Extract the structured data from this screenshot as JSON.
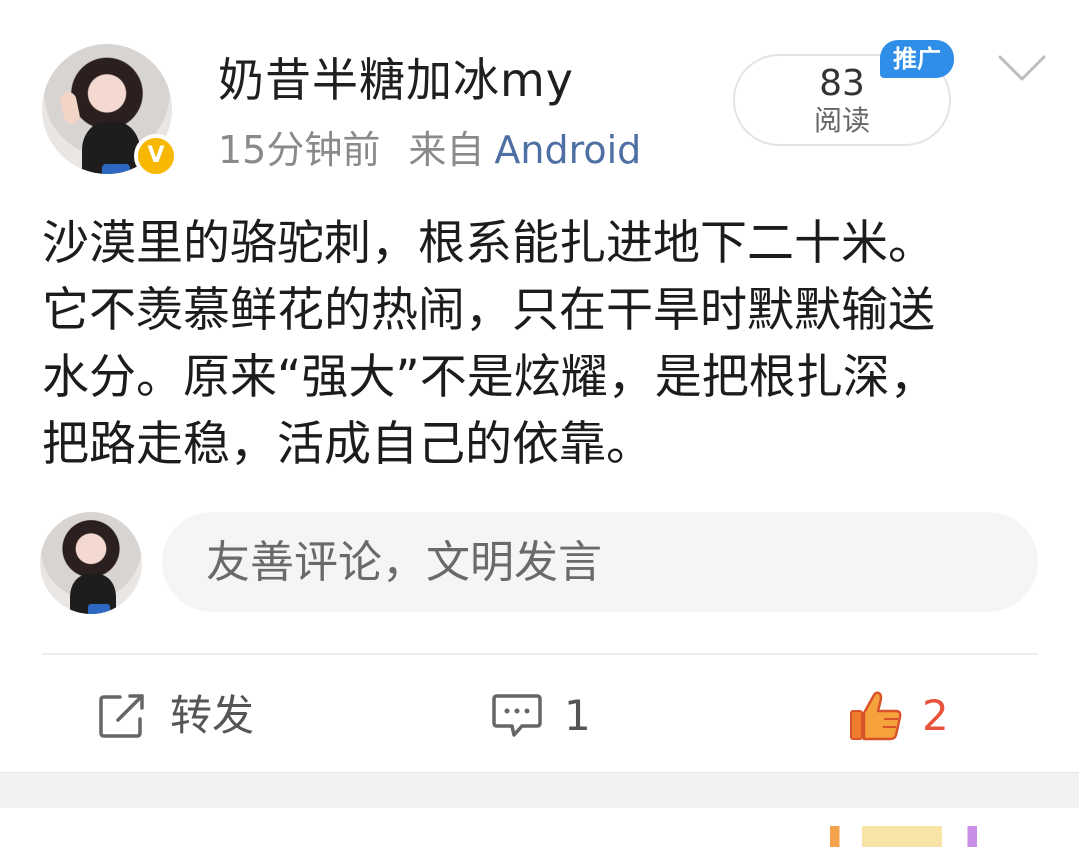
{
  "post": {
    "author": {
      "name": "奶昔半糖加冰my",
      "verified_badge": "V"
    },
    "time": "15分钟前",
    "source_prefix": "来自",
    "source": "Android",
    "read_count": "83",
    "read_label": "阅读",
    "promo_tag": "推广",
    "content_lines": [
      "沙漠里的骆驼刺，根系能扎进地下二十米。",
      "它不羡慕鲜花的热闹，只在干旱时默默输送",
      "水分。原来“强大”不是炫耀，是把根扎深，",
      "把路走稳，活成自己的依靠。"
    ]
  },
  "comment_box": {
    "placeholder": "友善评论，文明发言"
  },
  "actions": {
    "repost_label": "转发",
    "comment_count": "1",
    "like_count": "2"
  },
  "icons": {
    "more": "chevron-down-icon",
    "repost": "repost-icon",
    "comment": "comment-icon",
    "like": "thumbs-up-icon"
  },
  "colors": {
    "link": "#4d6fa3",
    "like_accent": "#e8533b",
    "promo": "#2f8ee8",
    "verified": "#f6b800"
  }
}
